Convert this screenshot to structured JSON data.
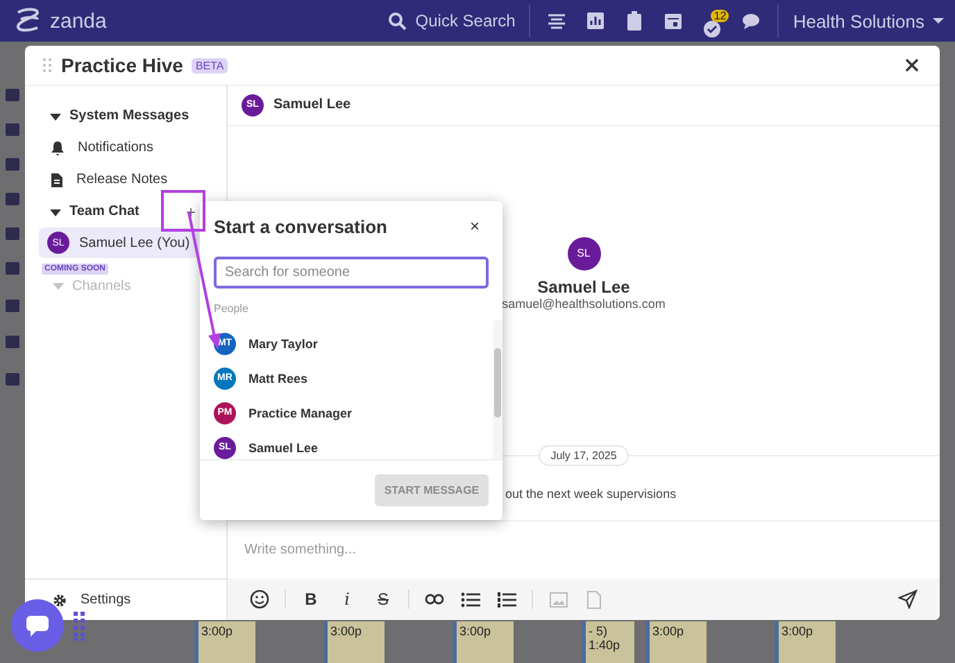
{
  "top_bar": {
    "logo": "zanda",
    "search": "Quick Search",
    "badge": "12",
    "account": "Health Solutions"
  },
  "calendar_events": [
    {
      "lines": [
        "3:00p"
      ]
    },
    {
      "lines": [
        "3:00p"
      ]
    },
    {
      "lines": [
        "3:00p"
      ]
    },
    {
      "lines": [
        "- 5)",
        "1:40p"
      ]
    },
    {
      "lines": [
        "3:00p"
      ]
    },
    {
      "lines": [
        "3:00p"
      ]
    }
  ],
  "modal": {
    "title": "Practice Hive",
    "tag": "BETA"
  },
  "sidebar": {
    "system_messages": {
      "label": "System Messages",
      "expanded": true,
      "items": [
        "Notifications",
        "Release Notes"
      ]
    },
    "team_chat": {
      "label": "Team Chat",
      "expanded": true,
      "add": "+",
      "users": [
        {
          "initials": "SL",
          "name": "Samuel Lee (You)",
          "selected": true,
          "color": "#6a1b9a"
        }
      ]
    },
    "channels": {
      "badge": "COMING SOON",
      "label": "Channels",
      "disabled": true
    },
    "settings": "Settings"
  },
  "chat": {
    "header": {
      "initials": "SL",
      "name": "Samuel Lee"
    },
    "profile": {
      "initials": "SL",
      "name": "Samuel Lee",
      "email": "samuel@healthsolutions.com"
    },
    "date": "July 17, 2025",
    "message": "out the next week supervisions",
    "placeholder": "Write something...",
    "format_buttons": [
      "B",
      "i",
      "S"
    ]
  },
  "popover": {
    "title": "Start a conversation",
    "close": "×",
    "placeholder": "Search for someone",
    "section": "People",
    "people": [
      {
        "initials": "MT",
        "name": "Mary Taylor",
        "color": "#1565c0"
      },
      {
        "initials": "MR",
        "name": "Matt Rees",
        "color": "#0277bd"
      },
      {
        "initials": "PM",
        "name": "Practice Manager",
        "color": "#ad1457"
      },
      {
        "initials": "SL",
        "name": "Samuel Lee",
        "color": "#6a1b9a"
      }
    ],
    "button": {
      "label": "START MESSAGE",
      "disabled": true
    }
  }
}
